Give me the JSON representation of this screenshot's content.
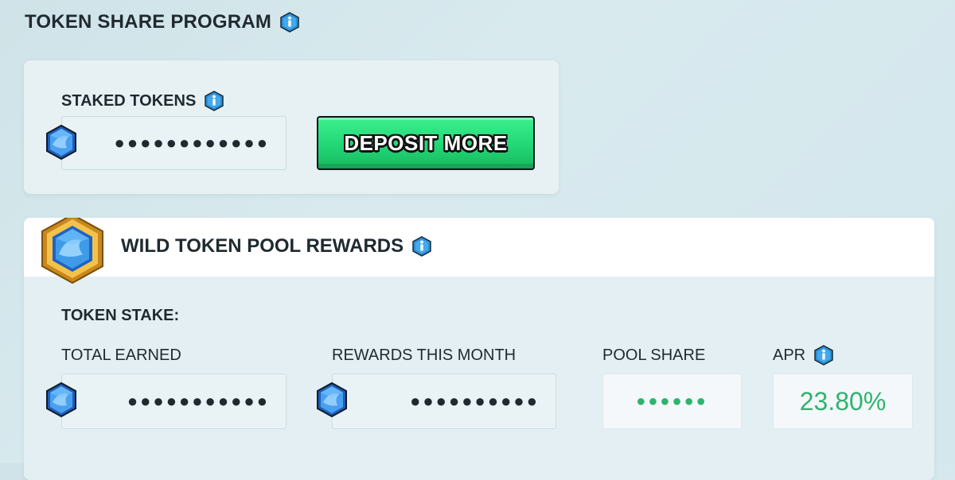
{
  "page": {
    "title": "TOKEN SHARE PROGRAM"
  },
  "staked": {
    "label": "STAKED TOKENS",
    "value": "●●●●●●●●●●●●",
    "deposit_label": "DEPOSIT MORE"
  },
  "pool": {
    "title": "WILD TOKEN POOL REWARDS",
    "section_label": "TOKEN STAKE:",
    "total_earned": {
      "label": "TOTAL EARNED",
      "value": "●●●●●●●●●●●"
    },
    "rewards_month": {
      "label": "REWARDS THIS MONTH",
      "value": "●●●●●●●●●●"
    },
    "pool_share": {
      "label": "POOL SHARE",
      "value": "●●●●●●"
    },
    "apr": {
      "label": "APR",
      "value": "23.80%"
    }
  },
  "colors": {
    "accent_green": "#2fb36f",
    "button_green": "#22d676",
    "info_blue": "#2a8fd6"
  },
  "icons": [
    "info-icon",
    "token-gem-icon",
    "pool-badge-icon"
  ]
}
